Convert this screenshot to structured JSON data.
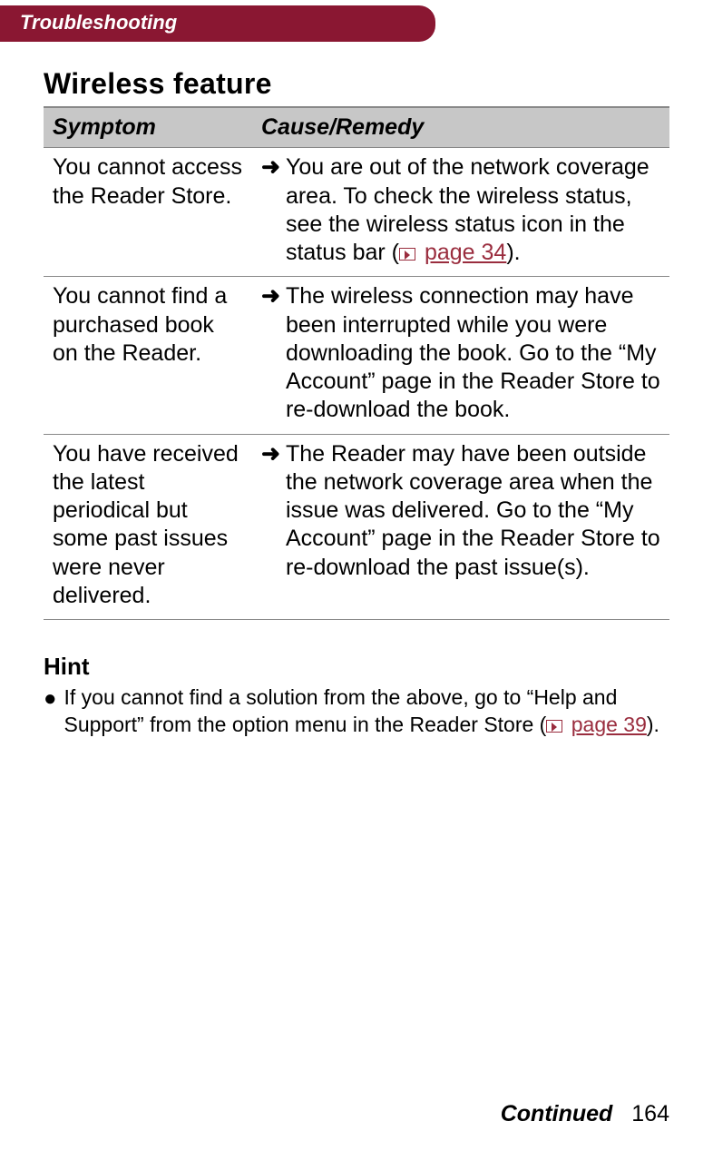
{
  "header": {
    "tab": "Troubleshooting"
  },
  "section": {
    "title": "Wireless feature",
    "columns": {
      "symptom": "Symptom",
      "remedy": "Cause/Remedy"
    },
    "rows": [
      {
        "symptom": "You cannot access the Reader Store.",
        "remedy_pre": "You are out of the network coverage area. To check the wireless status, see the wireless status icon in the status bar (",
        "remedy_link": "page 34",
        "remedy_post": ")."
      },
      {
        "symptom": "You cannot find a purchased book on the Reader.",
        "remedy_pre": "The wireless connection may have been interrupted while you were downloading the book. Go to the “My Account” page in the Reader Store to re-download the book.",
        "remedy_link": "",
        "remedy_post": ""
      },
      {
        "symptom": "You have received the latest periodical but some past issues were never delivered.",
        "remedy_pre": "The Reader may have been outside the network coverage area when the issue was delivered. Go to the “My Account” page in the Reader Store to re-download the past issue(s).",
        "remedy_link": "",
        "remedy_post": ""
      }
    ]
  },
  "hint": {
    "title": "Hint",
    "text_pre": "If you cannot find a solution from the above, go to “Help and Support” from the option menu in the Reader Store (",
    "link": "page 39",
    "text_post": ")."
  },
  "footer": {
    "continued": "Continued",
    "page_number": "164"
  },
  "glyphs": {
    "arrow": "➜",
    "bullet": "●"
  }
}
